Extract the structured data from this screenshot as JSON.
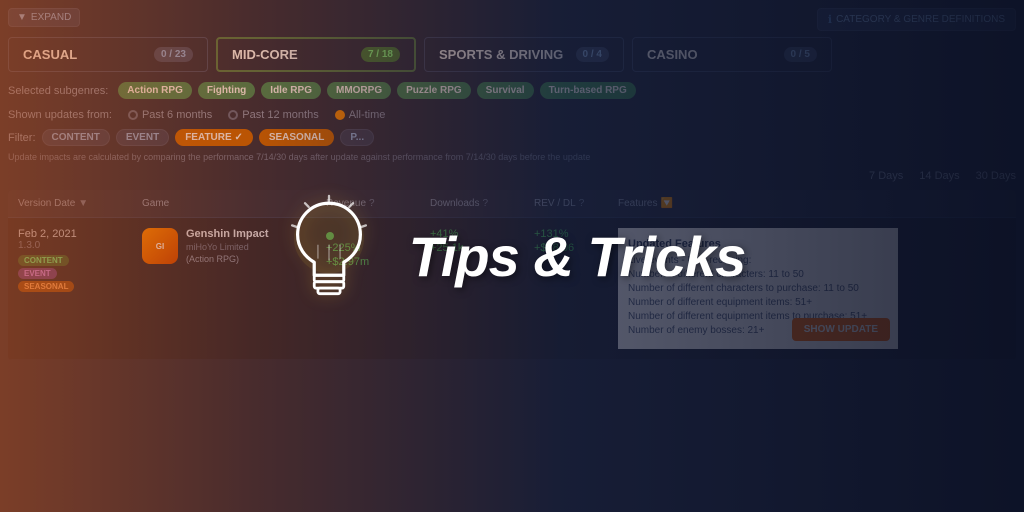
{
  "topBar": {
    "expandLabel": "EXPAND",
    "categoryGenreBtn": "CATEGORY & GENRE DEFINITIONS"
  },
  "categories": [
    {
      "id": "casual",
      "label": "CASUAL",
      "badge": "0 / 23",
      "badgeType": "gray"
    },
    {
      "id": "midcore",
      "label": "MID-CORE",
      "badge": "7 / 18",
      "badgeType": "green"
    },
    {
      "id": "sports",
      "label": "SPORTS & DRIVING",
      "badge": "0 / 4",
      "badgeType": "gray"
    },
    {
      "id": "casino",
      "label": "CASINO",
      "badge": "0 / 5",
      "badgeType": "gray"
    }
  ],
  "subgenres": {
    "label": "Selected subgenres:",
    "tags": [
      "Action RPG",
      "Fighting",
      "Idle RPG",
      "MMORPG",
      "Puzzle RPG",
      "Survival",
      "Turn-based RPG"
    ]
  },
  "updatesFrom": {
    "label": "Shown updates from:",
    "options": [
      "Past 6 months",
      "Past 12 months",
      "All-time"
    ],
    "selected": "All-time"
  },
  "filters": {
    "label": "Filter:",
    "tags": [
      {
        "label": "CONTENT",
        "type": "gray"
      },
      {
        "label": "EVENT",
        "type": "gray"
      },
      {
        "label": "FEATURE ✓",
        "type": "orange"
      },
      {
        "label": "SEASONAL",
        "type": "orange"
      },
      {
        "label": "P...",
        "type": "gray"
      }
    ]
  },
  "impactsNote": "Update impacts are calculated by comparing the performance 7/14/30 days after update against performance from 7/14/30 days before the update",
  "daysOptions": [
    "7 Days",
    "14 Days",
    "30 Days"
  ],
  "tableHeaders": [
    "Version Date",
    "Game",
    "Revenue",
    "Downloads",
    "REV / DL",
    "Features"
  ],
  "tableRows": [
    {
      "versionDate": "Feb 2, 2021",
      "versionNum": "1.3.0",
      "gameName": "Genshin Impact",
      "gameCompany": "miHoYo Limited",
      "gameGenre": "(Action RPG)",
      "tags": [
        "CONTENT",
        "EVENT",
        "SEASONAL"
      ],
      "hasRevDot": true,
      "revenue": "+225%\n+$2.97m",
      "downloads": "+41%\n+25.1k",
      "revDl": "+131%\n+$28.06",
      "features": {
        "title": "Updated Features",
        "items": [
          "Live events - Non-recurring:",
          "Number of different characters: 11 to 50",
          "Number of different characters to purchase: 11 to 50",
          "Number of different equipment items: 51+",
          "Number of different equipment items to purchase: 51+",
          "Number of enemy bosses: 21+"
        ]
      }
    }
  ],
  "showUpdateBtn": "SHOW UPDATE",
  "tips": {
    "title": "Tips & Tricks",
    "lightbulb": "💡"
  }
}
